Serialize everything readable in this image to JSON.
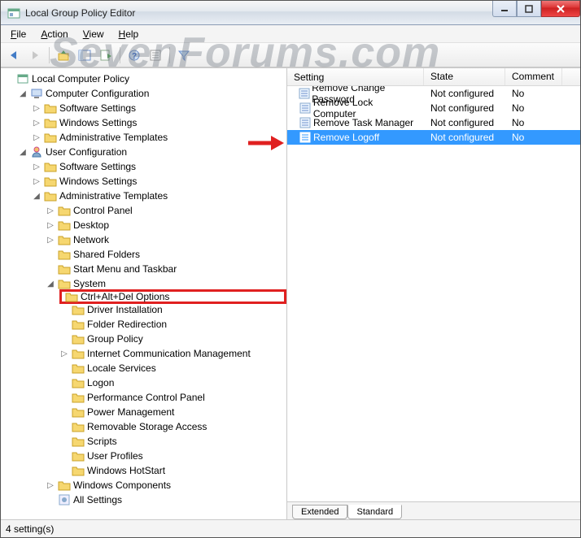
{
  "window": {
    "title": "Local Group Policy Editor"
  },
  "menu": {
    "file": "File",
    "action": "Action",
    "view": "View",
    "help": "Help"
  },
  "tree": {
    "root": "Local Computer Policy",
    "computer_config": "Computer Configuration",
    "cc_software": "Software Settings",
    "cc_windows": "Windows Settings",
    "cc_admin": "Administrative Templates",
    "user_config": "User Configuration",
    "uc_software": "Software Settings",
    "uc_windows": "Windows Settings",
    "uc_admin": "Administrative Templates",
    "control_panel": "Control Panel",
    "desktop": "Desktop",
    "network": "Network",
    "shared_folders": "Shared Folders",
    "start_menu": "Start Menu and Taskbar",
    "system": "System",
    "ctrl_alt_del": "Ctrl+Alt+Del Options",
    "driver_install": "Driver Installation",
    "folder_redir": "Folder Redirection",
    "group_policy": "Group Policy",
    "internet_comm": "Internet Communication Management",
    "locale": "Locale Services",
    "logon": "Logon",
    "perf_cp": "Performance Control Panel",
    "power_mgmt": "Power Management",
    "removable": "Removable Storage Access",
    "scripts": "Scripts",
    "user_profiles": "User Profiles",
    "hotstart": "Windows HotStart",
    "win_components": "Windows Components",
    "all_settings": "All Settings"
  },
  "list": {
    "columns": {
      "setting": "Setting",
      "state": "State",
      "comment": "Comment"
    },
    "rows": [
      {
        "setting": "Remove Change Password",
        "state": "Not configured",
        "comment": "No",
        "selected": false
      },
      {
        "setting": "Remove Lock Computer",
        "state": "Not configured",
        "comment": "No",
        "selected": false
      },
      {
        "setting": "Remove Task Manager",
        "state": "Not configured",
        "comment": "No",
        "selected": false
      },
      {
        "setting": "Remove Logoff",
        "state": "Not configured",
        "comment": "No",
        "selected": true
      }
    ],
    "tabs": {
      "extended": "Extended",
      "standard": "Standard"
    }
  },
  "status": {
    "text": "4 setting(s)"
  },
  "watermark": "SevenForums.com"
}
